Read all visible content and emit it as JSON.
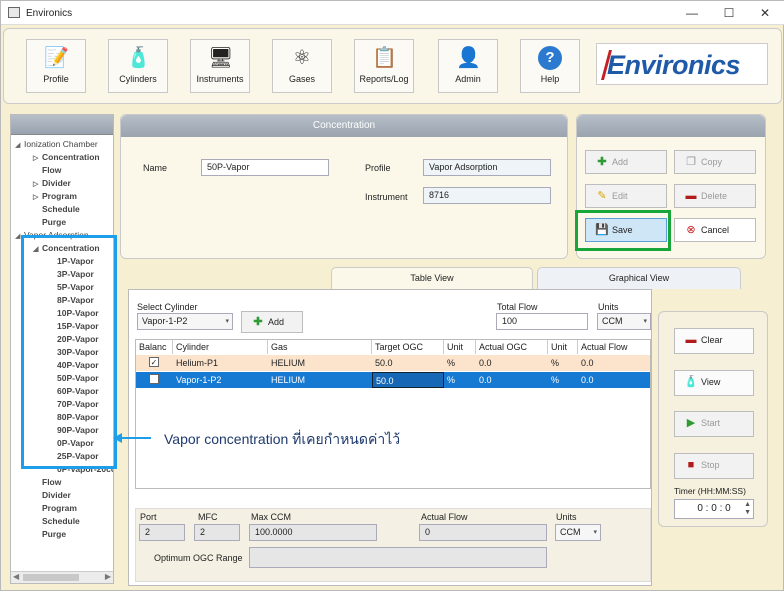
{
  "window": {
    "title": "Environics",
    "minimize": "—",
    "maximize": "☐",
    "close": "✕"
  },
  "toolbar": [
    {
      "label": "Profile",
      "icon": "📝"
    },
    {
      "label": "Cylinders",
      "icon": "🧴"
    },
    {
      "label": "Instruments",
      "icon": "🖥"
    },
    {
      "label": "Gases",
      "icon": "⚛"
    },
    {
      "label": "Reports/Log",
      "icon": "📋"
    },
    {
      "label": "Admin",
      "icon": "👤"
    },
    {
      "label": "Help",
      "icon": "?"
    }
  ],
  "logo": "Environics",
  "tree": {
    "ionization": {
      "label": "Ionization Chamber",
      "children": [
        "Concentration",
        "Flow",
        "Divider",
        "Program",
        "Schedule",
        "Purge"
      ]
    },
    "vapor": {
      "label": "Vapor Adsorption",
      "concentration": "Concentration",
      "items": [
        "1P-Vapor",
        "3P-Vapor",
        "5P-Vapor",
        "8P-Vapor",
        "10P-Vapor",
        "15P-Vapor",
        "20P-Vapor",
        "30P-Vapor",
        "40P-Vapor",
        "50P-Vapor",
        "60P-Vapor",
        "70P-Vapor",
        "80P-Vapor",
        "90P-Vapor",
        "0P-Vapor",
        "25P-Vapor",
        "0P-Vapor-20cc"
      ],
      "after": [
        "Flow",
        "Divider",
        "Program",
        "Schedule",
        "Purge"
      ]
    }
  },
  "concentration": {
    "header": "Concentration",
    "name_label": "Name",
    "name_value": "50P-Vapor",
    "profile_label": "Profile",
    "profile_value": "Vapor Adsorption",
    "instrument_label": "Instrument",
    "instrument_value": "8716"
  },
  "actions": {
    "add": "Add",
    "copy": "Copy",
    "edit": "Edit",
    "delete": "Delete",
    "save": "Save",
    "cancel": "Cancel"
  },
  "tabs": {
    "table": "Table View",
    "graphical": "Graphical View"
  },
  "table_view": {
    "select_cylinder_label": "Select Cylinder",
    "select_cylinder_value": "Vapor-1-P2",
    "add_label": "Add",
    "total_flow_label": "Total Flow",
    "total_flow_value": "100",
    "units_label": "Units",
    "units_value": "CCM",
    "columns": [
      "Balanc",
      "Cylinder",
      "Gas",
      "Target OGC",
      "Unit",
      "Actual OGC",
      "Unit",
      "Actual Flow"
    ],
    "rows": [
      {
        "balance": "✓",
        "cylinder": "Helium-P1",
        "gas": "HELIUM",
        "target": "50.0",
        "unit1": "%",
        "actual": "0.0",
        "unit2": "%",
        "flow": "0.0"
      },
      {
        "balance": "",
        "cylinder": "Vapor-1-P2",
        "gas": "HELIUM",
        "target": "50.0",
        "unit1": "%",
        "actual": "0.0",
        "unit2": "%",
        "flow": "0.0"
      }
    ]
  },
  "details": {
    "port_label": "Port",
    "port_value": "2",
    "mfc_label": "MFC",
    "mfc_value": "2",
    "maxccm_label": "Max CCM",
    "maxccm_value": "100.0000",
    "actualflow_label": "Actual Flow",
    "actualflow_value": "0",
    "units_label": "Units",
    "units_value": "CCM",
    "ogc_range_label": "Optimum OGC Range"
  },
  "controls": {
    "clear": "Clear",
    "view": "View",
    "start": "Start",
    "stop": "Stop",
    "timer_label": "Timer (HH:MM:SS)",
    "timer_h": "0",
    "timer_m": "0",
    "timer_s": "0",
    "sep": ":"
  },
  "annotation": "Vapor concentration ที่เคยกำหนดค่าไว้",
  "colors": {
    "accent": "#1e9ee8",
    "save_highlight": "#18a53a",
    "selected_row": "#1679d2",
    "balance_row": "#fbe3cc"
  }
}
